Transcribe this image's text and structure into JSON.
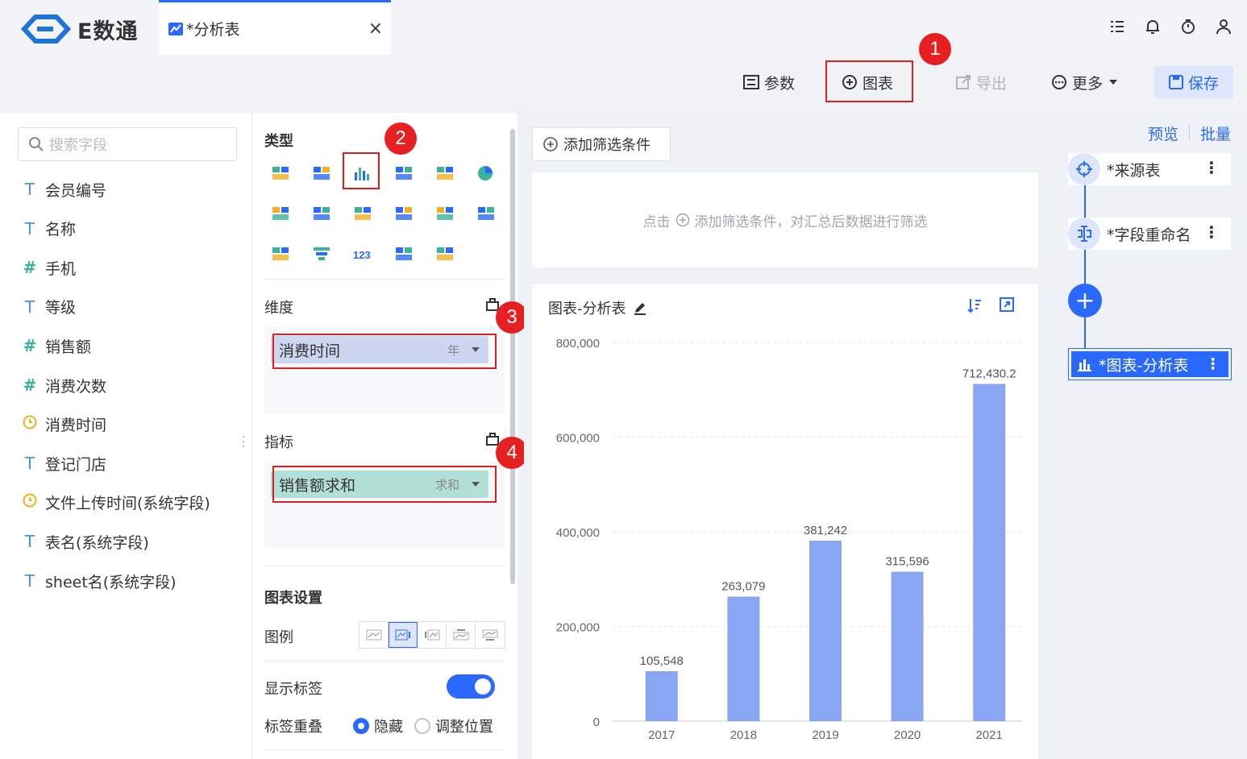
{
  "app": {
    "logo_text": "E数通"
  },
  "tab": {
    "label": "*分析表",
    "close": "×"
  },
  "toolbar": {
    "params": "参数",
    "chart": "图表",
    "export": "导出",
    "more": "更多",
    "save": "保存"
  },
  "markers": [
    "1",
    "2",
    "3",
    "4"
  ],
  "search": {
    "placeholder": "搜索字段"
  },
  "fields": [
    {
      "type": "T",
      "label": "会员编号"
    },
    {
      "type": "T",
      "label": "名称"
    },
    {
      "type": "#",
      "label": "手机"
    },
    {
      "type": "T",
      "label": "等级"
    },
    {
      "type": "#",
      "label": "销售额"
    },
    {
      "type": "#",
      "label": "消费次数"
    },
    {
      "type": "clock",
      "label": "消费时间"
    },
    {
      "type": "T",
      "label": "登记门店"
    },
    {
      "type": "clock",
      "label": "文件上传时间(系统字段)"
    },
    {
      "type": "T",
      "label": "表名(系统字段)"
    },
    {
      "type": "T",
      "label": "sheet名(系统字段)"
    }
  ],
  "config": {
    "type_title": "类型",
    "dimension_title": "维度",
    "dimension_pill": {
      "label": "消费时间",
      "agg": "年"
    },
    "metric_title": "指标",
    "metric_pill": {
      "label": "销售额求和",
      "agg": "求和"
    },
    "chart_settings_title": "图表设置",
    "legend_label": "图例",
    "show_labels_label": "显示标签",
    "label_overlap_label": "标签重叠",
    "overlap_hide": "隐藏",
    "overlap_adjust": "调整位置"
  },
  "filter": {
    "add_button": "添加筛选条件",
    "hint_prefix": "点击",
    "hint_suffix": "添加筛选条件，对汇总后数据进行筛选"
  },
  "chart_title": "图表-分析表",
  "chart_data": {
    "type": "bar",
    "categories": [
      "2017",
      "2018",
      "2019",
      "2020",
      "2021"
    ],
    "values": [
      105548,
      263079,
      381242,
      315596,
      712430.2
    ],
    "value_labels": [
      "105,548",
      "263,079",
      "381,242",
      "315,596",
      "712,430.2"
    ],
    "ylim": [
      0,
      800000
    ],
    "yticks": [
      "0",
      "200,000",
      "400,000",
      "600,000",
      "800,000"
    ],
    "bar_color": "#89a6f3",
    "grid": true
  },
  "flow": {
    "preview": "预览",
    "batch": "批量",
    "nodes": [
      {
        "label": "*来源表"
      },
      {
        "label": "*字段重命名"
      },
      {
        "label": "*图表-分析表"
      }
    ]
  },
  "colors": {
    "accent": "#2a69ff",
    "marker": "#e62020"
  }
}
